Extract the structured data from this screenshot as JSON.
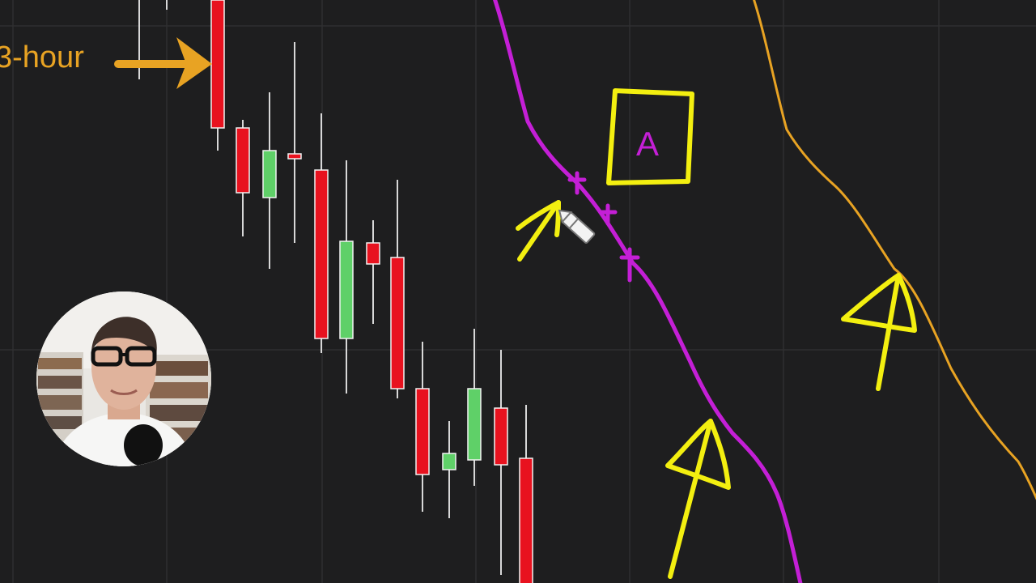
{
  "annotations": {
    "timeframe_label": "3-hour",
    "box_letter": "A"
  },
  "colors": {
    "background": "#1e1e1f",
    "grid": "#2f2f31",
    "bullish": "#5fd068",
    "bearish": "#e8121f",
    "wick": "#d8d8d8",
    "magenta_line": "#c41fd6",
    "orange_line": "#e8a323",
    "annotation_yellow": "#f3ef10",
    "annotation_orange": "#e8a323"
  },
  "icons": {
    "arrow": "arrow-right-icon",
    "cursor": "pencil-cursor-icon"
  },
  "chart_data": {
    "type": "candlestick",
    "grid": true,
    "series": [
      {
        "name": "",
        "type": "candlestick",
        "values": [
          {
            "open": 158,
            "close": 0,
            "high": -10,
            "low": 186,
            "direction": "down"
          },
          {
            "open": 158,
            "close": 238,
            "high": 148,
            "low": 292,
            "direction": "down"
          },
          {
            "open": 244,
            "close": 186,
            "high": 114,
            "low": 332,
            "direction": "up"
          },
          {
            "open": 190,
            "close": 196,
            "high": 52,
            "low": 300,
            "direction": "down"
          },
          {
            "open": 210,
            "close": 418,
            "high": 140,
            "low": 436,
            "direction": "down"
          },
          {
            "open": 418,
            "close": 298,
            "high": 198,
            "low": 486,
            "direction": "up"
          },
          {
            "open": 300,
            "close": 326,
            "high": 272,
            "low": 400,
            "direction": "down"
          },
          {
            "open": 318,
            "close": 480,
            "high": 222,
            "low": 492,
            "direction": "down"
          },
          {
            "open": 480,
            "close": 586,
            "high": 422,
            "low": 632,
            "direction": "down"
          },
          {
            "open": 580,
            "close": 560,
            "high": 520,
            "low": 640,
            "direction": "up"
          },
          {
            "open": 568,
            "close": 480,
            "high": 406,
            "low": 600,
            "direction": "up"
          },
          {
            "open": 504,
            "close": 574,
            "high": 432,
            "low": 710,
            "direction": "down"
          },
          {
            "open": 566,
            "close": 730,
            "high": 500,
            "low": 740,
            "direction": "down"
          }
        ]
      }
    ]
  }
}
